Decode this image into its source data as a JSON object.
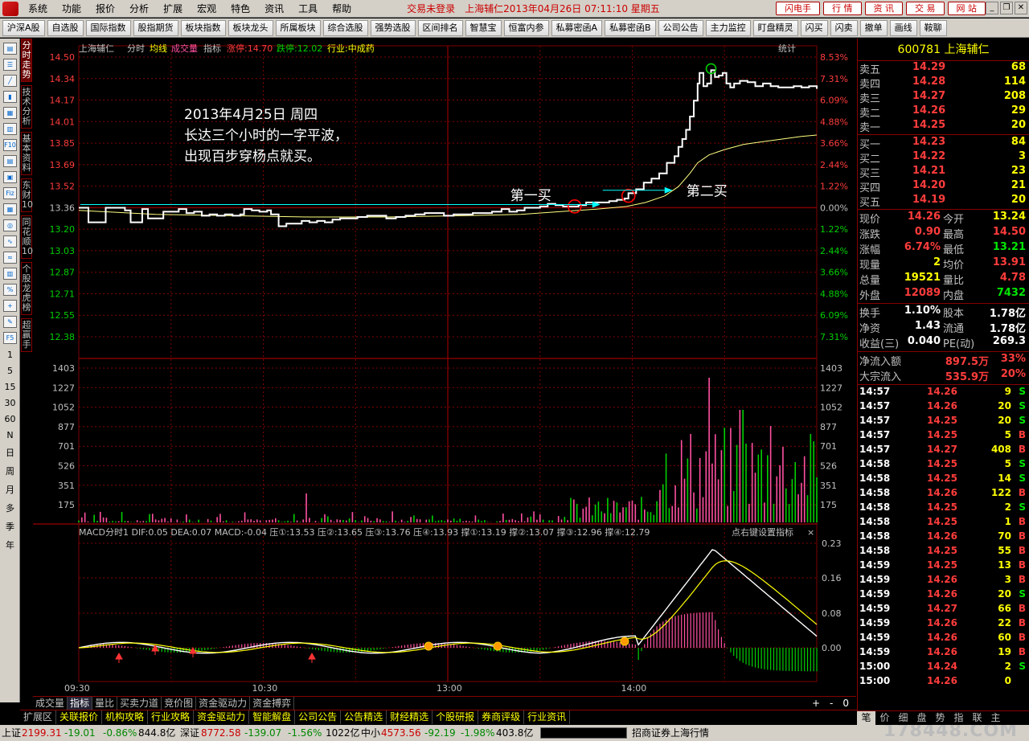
{
  "menubar": {
    "menus": [
      "系统",
      "功能",
      "报价",
      "分析",
      "扩展",
      "宏观",
      "特色",
      "资讯",
      "工具",
      "帮助"
    ],
    "status": "交易未登录",
    "title": "上海辅仁2013年04月26日  07:11:10 星期五",
    "buttons": [
      "闪电手",
      "行  情",
      "资  讯",
      "交  易",
      "网  站"
    ]
  },
  "toolbar": [
    "沪深A股",
    "自选股",
    "国际指数",
    "股指期货",
    "板块指数",
    "板块龙头",
    "所属板块",
    "综合选股",
    "强势选股",
    "区间排名",
    "智慧宝",
    "恒富内参",
    "私募密函A",
    "私募密函B",
    "公司公告",
    "主力监控",
    "盯盘精灵",
    "闪买",
    "闪卖",
    "撤单",
    "画线",
    "鞍聊"
  ],
  "left_tabs": [
    "分时走势",
    "技术分析",
    "基本资料",
    "东财10",
    "同花顺10",
    "个股龙虎榜",
    "超赢手"
  ],
  "left_periods": [
    "1",
    "5",
    "15",
    "30",
    "60",
    "N",
    "日",
    "周",
    "月",
    "多",
    "季",
    "年"
  ],
  "chart": {
    "header": {
      "name": "上海辅仁",
      "items": [
        "分时",
        "均线"
      ],
      "vol": "成交量",
      "indicator": "指标",
      "limit_up": "涨停:14.70",
      "limit_down": "跌停:12.02",
      "industry": "行业:中成药",
      "stats": "统计"
    },
    "price_ticks": [
      "14.50",
      "14.34",
      "14.17",
      "14.01",
      "13.85",
      "13.69",
      "13.52",
      "13.36",
      "13.20",
      "13.03",
      "12.87",
      "12.71",
      "12.55",
      "12.38"
    ],
    "pct_ticks": [
      "8.53%",
      "7.31%",
      "6.09%",
      "4.88%",
      "3.66%",
      "2.44%",
      "1.22%",
      "0.00%",
      "1.22%",
      "2.44%",
      "3.66%",
      "4.88%",
      "6.09%",
      "7.31%"
    ],
    "vol_ticks": [
      "1403",
      "1227",
      "1052",
      "877",
      "701",
      "526",
      "351",
      "175"
    ],
    "macd_header": "MACD分时1  DIF:0.05  DEA:0.07  MACD:-0.04  压①:13.53  压②:13.65  压③:13.76  压④:13.93  撑①:13.19  撑②:13.07  撑③:12.96  撑④:12.79",
    "macd_hint": "点右键设置指标",
    "macd_ticks": [
      "0.23",
      "0.16",
      "0.08",
      "0.00"
    ],
    "time_ticks": [
      "09:30",
      "10:30",
      "13:00",
      "14:00"
    ],
    "annotation": {
      "line1": "2013年4月25日  周四",
      "line2": "长达三个小时的一字平波，",
      "line3": "出现百步穿杨点就买。"
    },
    "label_buy1": "第一买",
    "label_buy2": "第二买",
    "colors": {
      "price_line": "#ffffff",
      "avg_line": "#ffff80",
      "up": "#ff50a0",
      "down": "#00d000",
      "grid": "#800000"
    }
  },
  "quote": {
    "title": "600781  上海辅仁",
    "asks": [
      {
        "label": "卖五",
        "price": "14.29",
        "vol": "68"
      },
      {
        "label": "卖四",
        "price": "14.28",
        "vol": "114"
      },
      {
        "label": "卖三",
        "price": "14.27",
        "vol": "208"
      },
      {
        "label": "卖二",
        "price": "14.26",
        "vol": "29"
      },
      {
        "label": "卖一",
        "price": "14.25",
        "vol": "20"
      }
    ],
    "bids": [
      {
        "label": "买一",
        "price": "14.23",
        "vol": "84"
      },
      {
        "label": "买二",
        "price": "14.22",
        "vol": "3"
      },
      {
        "label": "买三",
        "price": "14.21",
        "vol": "23"
      },
      {
        "label": "买四",
        "price": "14.20",
        "vol": "21"
      },
      {
        "label": "买五",
        "price": "14.19",
        "vol": "20"
      }
    ],
    "fields": [
      [
        "现价",
        "14.26",
        "今开",
        "13.24"
      ],
      [
        "涨跌",
        "0.90",
        "最高",
        "14.50"
      ],
      [
        "涨幅",
        "6.74%",
        "最低",
        "13.21"
      ],
      [
        "现量",
        "2",
        "均价",
        "13.91"
      ],
      [
        "总量",
        "19521",
        "量比",
        "4.78"
      ],
      [
        "外盘",
        "12089",
        "内盘",
        "7432"
      ]
    ],
    "fields2": [
      [
        "换手",
        "1.10%",
        "股本",
        "1.78亿"
      ],
      [
        "净资",
        "1.43",
        "流通",
        "1.78亿"
      ],
      [
        "收益(三)",
        "0.040",
        "PE(动)",
        "269.3"
      ]
    ],
    "flow": [
      [
        "净流入额",
        "897.5万",
        "33%"
      ],
      [
        "大宗流入",
        "535.9万",
        "20%"
      ]
    ],
    "ticks": [
      [
        "14:57",
        "14.26",
        "9",
        "S"
      ],
      [
        "14:57",
        "14.26",
        "20",
        "S"
      ],
      [
        "14:57",
        "14.25",
        "20",
        "S"
      ],
      [
        "14:57",
        "14.25",
        "5",
        "B"
      ],
      [
        "14:57",
        "14.27",
        "408",
        "B"
      ],
      [
        "14:58",
        "14.25",
        "5",
        "S"
      ],
      [
        "14:58",
        "14.25",
        "14",
        "S"
      ],
      [
        "14:58",
        "14.26",
        "122",
        "B"
      ],
      [
        "14:58",
        "14.25",
        "2",
        "S"
      ],
      [
        "14:58",
        "14.25",
        "1",
        "B"
      ],
      [
        "14:58",
        "14.26",
        "70",
        "B"
      ],
      [
        "14:58",
        "14.25",
        "55",
        "B"
      ],
      [
        "14:59",
        "14.25",
        "13",
        "B"
      ],
      [
        "14:59",
        "14.26",
        "3",
        "B"
      ],
      [
        "14:59",
        "14.26",
        "20",
        "S"
      ],
      [
        "14:59",
        "14.27",
        "66",
        "B"
      ],
      [
        "14:59",
        "14.26",
        "22",
        "B"
      ],
      [
        "14:59",
        "14.26",
        "60",
        "B"
      ],
      [
        "14:59",
        "14.26",
        "19",
        "B"
      ],
      [
        "15:00",
        "14.24",
        "2",
        "S"
      ],
      [
        "15:00",
        "14.26",
        "0",
        ""
      ]
    ],
    "tabs": [
      "笔",
      "价",
      "细",
      "盘",
      "势",
      "指",
      "联",
      "主"
    ]
  },
  "bottom_tabs": [
    "成交量",
    "指标",
    "量比",
    "买卖力道",
    "竞价图",
    "资金驱动力",
    "资金搏弈"
  ],
  "bottom_ctl": [
    "+",
    "-",
    "0"
  ],
  "ext_bar": [
    "扩展区",
    "关联报价",
    "机构攻略",
    "行业攻略",
    "资金驱动力",
    "智能解盘",
    "公司公告",
    "公告精选",
    "财经精选",
    "个股研报",
    "券商评级",
    "行业资讯"
  ],
  "statusbar": {
    "sh": {
      "label": "上证",
      "val": "2199.31",
      "chg": "-19.01",
      "pct": "-0.86%",
      "amt": "844.8亿"
    },
    "sz": {
      "label": "深证",
      "val": "8772.58",
      "chg": "-139.07",
      "pct": "-1.56%",
      "amt": "1022亿"
    },
    "zx": {
      "label": "中小",
      "val": "4573.56",
      "chg": "-92.19",
      "pct": "-1.98%",
      "amt": "403.8亿"
    },
    "broker": "招商证券上海行情",
    "watermark": "178448.COM"
  },
  "series": {
    "price": [
      [
        0,
        13.36
      ],
      [
        2,
        13.36
      ],
      [
        5,
        13.25
      ],
      [
        10,
        13.25
      ],
      [
        13,
        13.25
      ],
      [
        14,
        13.36
      ],
      [
        20,
        13.36
      ],
      [
        24,
        13.34
      ],
      [
        27,
        13.25
      ],
      [
        30,
        13.25
      ],
      [
        33,
        13.35
      ],
      [
        36,
        13.28
      ],
      [
        40,
        13.28
      ],
      [
        44,
        13.33
      ],
      [
        48,
        13.33
      ],
      [
        52,
        13.35
      ],
      [
        56,
        13.32
      ],
      [
        60,
        13.33
      ],
      [
        64,
        13.3
      ],
      [
        68,
        13.31
      ],
      [
        72,
        13.3
      ],
      [
        76,
        13.31
      ],
      [
        80,
        13.3
      ],
      [
        84,
        13.31
      ],
      [
        86,
        13.35
      ],
      [
        90,
        13.34
      ],
      [
        94,
        13.33
      ],
      [
        98,
        13.34
      ],
      [
        100,
        13.31
      ],
      [
        104,
        13.22
      ],
      [
        108,
        13.24
      ],
      [
        112,
        13.24
      ],
      [
        116,
        13.26
      ],
      [
        120,
        13.25
      ],
      [
        124,
        13.26
      ],
      [
        128,
        13.25
      ],
      [
        132,
        13.27
      ],
      [
        136,
        13.28
      ],
      [
        140,
        13.28
      ],
      [
        145,
        13.29
      ],
      [
        150,
        13.3
      ],
      [
        155,
        13.3
      ],
      [
        160,
        13.28
      ],
      [
        165,
        13.29
      ],
      [
        170,
        13.3
      ],
      [
        175,
        13.31
      ],
      [
        180,
        13.32
      ],
      [
        185,
        13.32
      ],
      [
        190,
        13.3
      ],
      [
        195,
        13.31
      ],
      [
        200,
        13.31
      ],
      [
        205,
        13.32
      ],
      [
        210,
        13.32
      ],
      [
        215,
        13.33
      ],
      [
        220,
        13.35
      ],
      [
        224,
        13.33
      ],
      [
        228,
        13.34
      ],
      [
        232,
        13.36
      ],
      [
        236,
        13.36
      ],
      [
        240,
        13.37
      ],
      [
        244,
        13.39
      ],
      [
        248,
        13.38
      ],
      [
        252,
        13.37
      ],
      [
        256,
        13.37
      ],
      [
        260,
        13.38
      ],
      [
        264,
        13.4
      ],
      [
        268,
        13.4
      ],
      [
        272,
        13.4
      ],
      [
        276,
        13.41
      ],
      [
        280,
        13.42
      ],
      [
        284,
        13.43
      ],
      [
        286,
        13.47
      ],
      [
        290,
        13.5
      ],
      [
        294,
        13.55
      ],
      [
        298,
        13.58
      ],
      [
        302,
        13.62
      ],
      [
        306,
        13.7
      ],
      [
        310,
        13.75
      ],
      [
        312,
        13.82
      ],
      [
        314,
        13.88
      ],
      [
        316,
        13.95
      ],
      [
        318,
        14.05
      ],
      [
        320,
        14.17
      ],
      [
        322,
        14.3
      ],
      [
        323,
        14.38
      ],
      [
        325,
        14.28
      ],
      [
        327,
        14.3
      ],
      [
        329,
        14.4
      ],
      [
        331,
        14.35
      ],
      [
        333,
        14.36
      ],
      [
        335,
        14.38
      ],
      [
        337,
        14.3
      ],
      [
        339,
        14.27
      ],
      [
        341,
        14.3
      ],
      [
        344,
        14.32
      ],
      [
        348,
        14.31
      ],
      [
        352,
        14.28
      ],
      [
        356,
        14.3
      ],
      [
        360,
        14.28
      ],
      [
        364,
        14.27
      ],
      [
        368,
        14.27
      ],
      [
        372,
        14.28
      ],
      [
        376,
        14.27
      ],
      [
        380,
        14.28
      ],
      [
        384,
        14.26
      ]
    ],
    "avg": [
      [
        0,
        13.34
      ],
      [
        40,
        13.31
      ],
      [
        80,
        13.3
      ],
      [
        120,
        13.29
      ],
      [
        160,
        13.29
      ],
      [
        200,
        13.3
      ],
      [
        230,
        13.31
      ],
      [
        250,
        13.33
      ],
      [
        270,
        13.35
      ],
      [
        285,
        13.37
      ],
      [
        295,
        13.4
      ],
      [
        305,
        13.45
      ],
      [
        312,
        13.52
      ],
      [
        318,
        13.62
      ],
      [
        322,
        13.7
      ],
      [
        328,
        13.76
      ],
      [
        336,
        13.8
      ],
      [
        346,
        13.84
      ],
      [
        356,
        13.86
      ],
      [
        366,
        13.88
      ],
      [
        376,
        13.9
      ],
      [
        384,
        13.91
      ]
    ]
  }
}
